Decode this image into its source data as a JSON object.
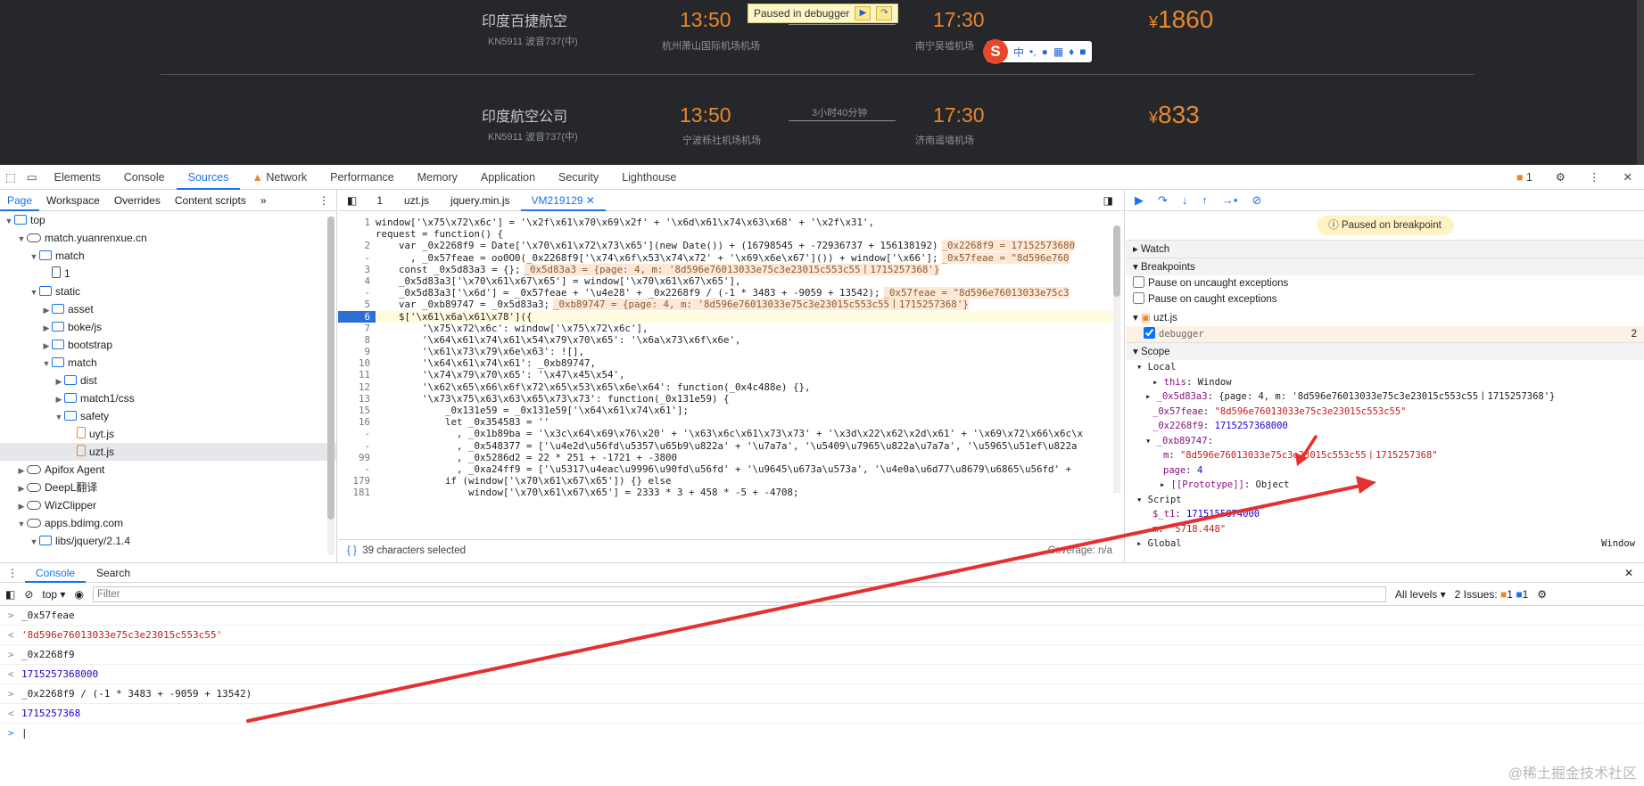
{
  "site": {
    "flights": [
      {
        "airline": "印度百捷航空",
        "code": "KN5911 波音737(中)",
        "dep_time": "13:50",
        "dep_airport": "杭州萧山国际机场机场",
        "arr_time": "17:30",
        "arr_airport": "南宁吴墟机场",
        "price": "1860",
        "currency": "¥",
        "duration": ""
      },
      {
        "airline": "印度航空公司",
        "code": "KN5911 波音737(中)",
        "dep_time": "13:50",
        "dep_airport": "宁波栎社机场机场",
        "arr_time": "17:30",
        "arr_airport": "济南遥墙机场",
        "price": "833",
        "currency": "¥",
        "duration": "3小时40分钟"
      }
    ],
    "paused_label": "Paused in debugger",
    "ime_items": [
      "中",
      "•,",
      "◖"
    ]
  },
  "devtools": {
    "tabs": [
      "Elements",
      "Console",
      "Sources",
      "Network",
      "Performance",
      "Memory",
      "Application",
      "Security",
      "Lighthouse"
    ],
    "active_tab": "Sources",
    "issues_count": "1",
    "navigator": {
      "tabs": [
        "Page",
        "Workspace",
        "Overrides",
        "Content scripts"
      ],
      "tree": [
        {
          "label": "top",
          "depth": 0,
          "type": "frame",
          "open": true
        },
        {
          "label": "match.yuanrenxue.cn",
          "depth": 1,
          "type": "cloud",
          "open": true
        },
        {
          "label": "match",
          "depth": 2,
          "type": "folder",
          "open": true
        },
        {
          "label": "1",
          "depth": 3,
          "type": "file"
        },
        {
          "label": "static",
          "depth": 2,
          "type": "folder",
          "open": true
        },
        {
          "label": "asset",
          "depth": 3,
          "type": "folder",
          "open": false
        },
        {
          "label": "boke/js",
          "depth": 3,
          "type": "folder",
          "open": false
        },
        {
          "label": "bootstrap",
          "depth": 3,
          "type": "folder",
          "open": false
        },
        {
          "label": "match",
          "depth": 3,
          "type": "folder",
          "open": true
        },
        {
          "label": "dist",
          "depth": 4,
          "type": "folder",
          "open": false
        },
        {
          "label": "match1/css",
          "depth": 4,
          "type": "folder",
          "open": false
        },
        {
          "label": "safety",
          "depth": 4,
          "type": "folder",
          "open": true
        },
        {
          "label": "uyt.js",
          "depth": 5,
          "type": "js"
        },
        {
          "label": "uzt.js",
          "depth": 5,
          "type": "js",
          "selected": true
        },
        {
          "label": "Apifox Agent",
          "depth": 1,
          "type": "cloud",
          "open": false
        },
        {
          "label": "DeepL翻译",
          "depth": 1,
          "type": "cloud",
          "open": false
        },
        {
          "label": "WizClipper",
          "depth": 1,
          "type": "cloud",
          "open": false
        },
        {
          "label": "apps.bdimg.com",
          "depth": 1,
          "type": "cloud",
          "open": true
        },
        {
          "label": "libs/jquery/2.1.4",
          "depth": 2,
          "type": "folder",
          "open": true
        }
      ]
    },
    "editor": {
      "tabs": [
        "1",
        "uzt.js",
        "jquery.min.js",
        "VM219129"
      ],
      "active_tab": "VM219129",
      "lines": [
        {
          "n": "1",
          "code": "window['\\x75\\x72\\x6c'] = '\\x2f\\x61\\x70\\x69\\x2f' + '\\x6d\\x61\\x74\\x63\\x68' + '\\x2f\\x31',",
          "inline": ""
        },
        {
          "n": "",
          "code": "request = function() {",
          "inline": ""
        },
        {
          "n": "2",
          "code": "    var _0x2268f9 = Date['\\x70\\x61\\x72\\x73\\x65'](new Date()) + (16798545 + -72936737 + 156138192)",
          "inline": "_0x2268f9 = 17152573680"
        },
        {
          "n": "-",
          "code": "      , _0x57feae = oo0O0(_0x2268f9['\\x74\\x6f\\x53\\x74\\x72' + '\\x69\\x6e\\x67']()) + window['\\x66'];",
          "inline": "_0x57feae = \"8d596e760"
        },
        {
          "n": "3",
          "code": "    const _0x5d83a3 = {};",
          "inline": "_0x5d83a3 = {page: 4, m: '8d596e76013033e75c3e23015c553c55丨1715257368'}"
        },
        {
          "n": "4",
          "code": "    _0x5d83a3['\\x70\\x61\\x67\\x65'] = window['\\x70\\x61\\x67\\x65'],",
          "inline": ""
        },
        {
          "n": "-",
          "code": "    _0x5d83a3['\\x6d'] = _0x57feae + '\\u4e28' + _0x2268f9 / (-1 * 3483 + -9059 + 13542);",
          "inline": "_0x57feae = \"8d596e76013033e75c3"
        },
        {
          "n": "5",
          "code": "    var _0xb89747 = _0x5d83a3;",
          "inline": "_0xb89747 = {page: 4, m: '8d596e76013033e75c3e23015c553c55丨1715257368'}"
        },
        {
          "n": "6",
          "code": "    $['\\x61\\x6a\\x61\\x78']({",
          "inline": "",
          "current": true
        },
        {
          "n": "7",
          "code": "        '\\x75\\x72\\x6c': window['\\x75\\x72\\x6c'],",
          "inline": ""
        },
        {
          "n": "8",
          "code": "        '\\x64\\x61\\x74\\x61\\x54\\x79\\x70\\x65': '\\x6a\\x73\\x6f\\x6e',",
          "inline": ""
        },
        {
          "n": "9",
          "code": "        '\\x61\\x73\\x79\\x6e\\x63': ![],",
          "inline": ""
        },
        {
          "n": "10",
          "code": "        '\\x64\\x61\\x74\\x61': _0xb89747,",
          "inline": ""
        },
        {
          "n": "11",
          "code": "        '\\x74\\x79\\x70\\x65': '\\x47\\x45\\x54',",
          "inline": ""
        },
        {
          "n": "12",
          "code": "        '\\x62\\x65\\x66\\x6f\\x72\\x65\\x53\\x65\\x6e\\x64': function(_0x4c488e) {},",
          "inline": ""
        },
        {
          "n": "13",
          "code": "        '\\x73\\x75\\x63\\x63\\x65\\x73\\x73': function(_0x131e59) {",
          "inline": ""
        },
        {
          "n": "15",
          "code": "            _0x131e59 = _0x131e59['\\x64\\x61\\x74\\x61'];",
          "inline": ""
        },
        {
          "n": "16",
          "code": "            let _0x354583 = ''",
          "inline": ""
        },
        {
          "n": "-",
          "code": "              , _0x1b89ba = '\\x3c\\x64\\x69\\x76\\x20' + '\\x63\\x6c\\x61\\x73\\x73' + '\\x3d\\x22\\x62\\x2d\\x61' + '\\x69\\x72\\x66\\x6c\\x",
          "inline": ""
        },
        {
          "n": "-",
          "code": "              , _0x548377 = ['\\u4e2d\\u56fd\\u5357\\u65b9\\u822a' + '\\u7a7a', '\\u5409\\u7965\\u822a\\u7a7a', '\\u5965\\u51ef\\u822a",
          "inline": ""
        },
        {
          "n": "99",
          "code": "              , _0x5286d2 = 22 * 251 + -1721 + -3800",
          "inline": ""
        },
        {
          "n": "-",
          "code": "              , _0xa24ff9 = ['\\u5317\\u4eac\\u9996\\u90fd\\u56fd' + '\\u9645\\u673a\\u573a', '\\u4e0a\\u6d77\\u8679\\u6865\\u56fd' +",
          "inline": ""
        },
        {
          "n": "179",
          "code": "            if (window['\\x70\\x61\\x67\\x65']) {} else",
          "inline": ""
        },
        {
          "n": "181",
          "code": "                window['\\x70\\x61\\x67\\x65'] = 2333 * 3 + 458 * -5 + -4708;",
          "inline": ""
        }
      ],
      "status": "39 characters selected",
      "coverage": "Coverage: n/a"
    },
    "debugger": {
      "paused_banner": "Paused on breakpoint",
      "watch": "Watch",
      "breakpoints": "Breakpoints",
      "pause_uncaught": "Pause on uncaught exceptions",
      "pause_caught": "Pause on caught exceptions",
      "bp_file": "uzt.js",
      "bp_item": "debugger",
      "bp_line": "2",
      "scope": "Scope",
      "local": "Local",
      "vars": [
        {
          "k": "this",
          "v": "Window"
        },
        {
          "k": "_0x5d83a3",
          "v": "{page: 4, m: '8d596e76013033e75c3e23015c553c55丨1715257368'}"
        },
        {
          "k": "_0x57feae",
          "v": "\"8d596e76013033e75c3e23015c553c55\""
        },
        {
          "k": "_0x2268f9",
          "v": "1715257368000"
        },
        {
          "k": "_0xb89747",
          "v": ""
        },
        {
          "k": "m",
          "v": "\"8d596e76013033e75c3e23015c553c55丨1715257368\""
        },
        {
          "k": "page",
          "v": "4"
        },
        {
          "k": "[[Prototype]]",
          "v": "Object"
        }
      ],
      "script": "Script",
      "script_vars": [
        {
          "k": "$_t1",
          "v": "1715155874000"
        },
        {
          "k": "m",
          "v": "\"5718.448\""
        }
      ],
      "global": "Global",
      "global_val": "Window"
    },
    "drawer": {
      "tabs": [
        "Console",
        "Search"
      ],
      "context": "top",
      "filter_placeholder": "Filter",
      "levels": "All levels",
      "issues": "2 Issues:",
      "issues_warn": "1",
      "issues_info": "1",
      "messages": [
        {
          "dir": ">",
          "text": "_0x57feae",
          "kind": "in"
        },
        {
          "dir": "<",
          "text": "'8d596e76013033e75c3e23015c553c55'",
          "kind": "str"
        },
        {
          "dir": ">",
          "text": "_0x2268f9",
          "kind": "in"
        },
        {
          "dir": "<",
          "text": "1715257368000",
          "kind": "num"
        },
        {
          "dir": ">",
          "text": "_0x2268f9 / (-1 * 3483 + -9059 + 13542)",
          "kind": "in"
        },
        {
          "dir": "<",
          "text": "1715257368",
          "kind": "num"
        },
        {
          "dir": ">",
          "text": "",
          "kind": "prompt"
        }
      ]
    }
  },
  "watermark": "@稀土掘金技术社区",
  "accent": "#1a73e8",
  "annotation_color": "#e53030"
}
